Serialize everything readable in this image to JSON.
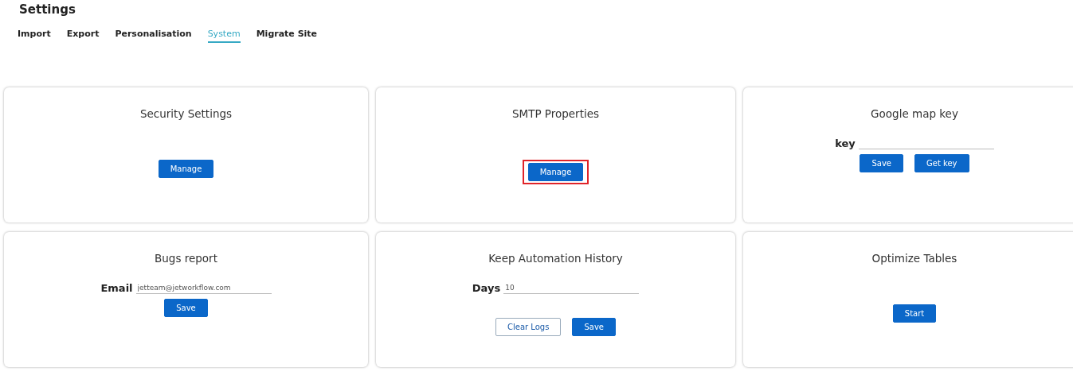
{
  "page": {
    "title": "Settings"
  },
  "tabs": [
    {
      "label": "Import",
      "selected": false
    },
    {
      "label": "Export",
      "selected": false
    },
    {
      "label": "Personalisation",
      "selected": false
    },
    {
      "label": "System",
      "selected": true
    },
    {
      "label": "Migrate Site",
      "selected": false
    }
  ],
  "cards": [
    {
      "title": "Security Settings",
      "buttons": [
        {
          "label": "Manage",
          "kind": "primary",
          "highlighted": false
        }
      ]
    },
    {
      "title": "SMTP Properties",
      "buttons": [
        {
          "label": "Manage",
          "kind": "primary",
          "highlighted": true
        }
      ]
    },
    {
      "title": "Google map key",
      "field": {
        "label": "key"
      },
      "buttons": [
        {
          "label": "Save",
          "kind": "primary",
          "highlighted": false
        },
        {
          "label": "Get key",
          "kind": "primary",
          "highlighted": false
        }
      ]
    },
    {
      "title": "Bugs report",
      "field": {
        "label": "Email",
        "value": "jetteam@jetworkflow.com"
      },
      "buttons": [
        {
          "label": "Save",
          "kind": "primary",
          "highlighted": false
        }
      ]
    },
    {
      "title": "Keep Automation History",
      "field": {
        "label": "Days",
        "value": "10"
      },
      "buttons": [
        {
          "label": "Clear Logs",
          "kind": "outline",
          "highlighted": false
        },
        {
          "label": "Save",
          "kind": "primary",
          "highlighted": false
        }
      ]
    },
    {
      "title": "Optimize Tables",
      "buttons": [
        {
          "label": "Start",
          "kind": "primary",
          "highlighted": false
        }
      ]
    }
  ]
}
